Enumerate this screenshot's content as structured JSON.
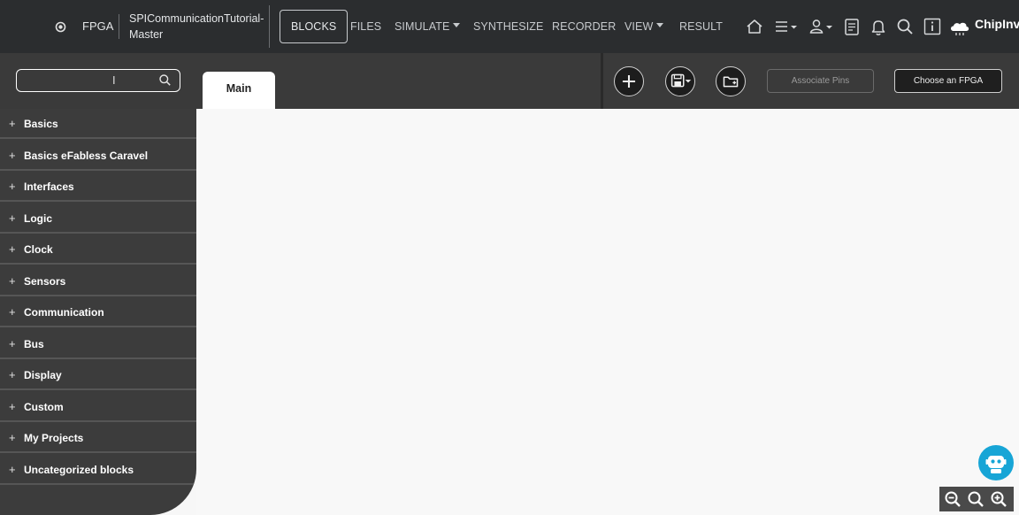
{
  "header": {
    "mode_label": "FPGA",
    "project_name": "SPICommunicationTutorial-Master",
    "nav": {
      "blocks": "BLOCKS",
      "files": "FILES",
      "simulate": "SIMULATE",
      "synthesize": "SYNTHESIZE",
      "recorder": "RECORDER",
      "view": "VIEW",
      "result": "RESULT"
    },
    "icons": [
      "home-icon",
      "menu-icon",
      "user-icon",
      "notes-icon",
      "bell-icon",
      "search-icon",
      "info-icon"
    ],
    "brand": "ChipInve"
  },
  "toolbar": {
    "search": {
      "value": "",
      "placeholder": ""
    },
    "tabs": [
      {
        "label": "Main",
        "active": true
      }
    ],
    "associate_pins_label": "Associate Pins",
    "choose_fpga_label": "Choose an FPGA"
  },
  "sidebar": {
    "categories": [
      {
        "label": "Basics"
      },
      {
        "label": "Basics eFabless Caravel"
      },
      {
        "label": "Interfaces"
      },
      {
        "label": "Logic"
      },
      {
        "label": "Clock"
      },
      {
        "label": "Sensors"
      },
      {
        "label": "Communication"
      },
      {
        "label": "Bus"
      },
      {
        "label": "Display"
      },
      {
        "label": "Custom"
      },
      {
        "label": "My Projects"
      },
      {
        "label": "Uncategorized blocks"
      }
    ],
    "expand_symbol": "+"
  },
  "colors": {
    "nav_bg": "#2b2d2f",
    "toolbar_bg": "#3a3a3a",
    "sidebar_bg": "#3c3c3c",
    "canvas_bg": "#f8f8f8",
    "assistant_accent": "#17a5d6"
  }
}
